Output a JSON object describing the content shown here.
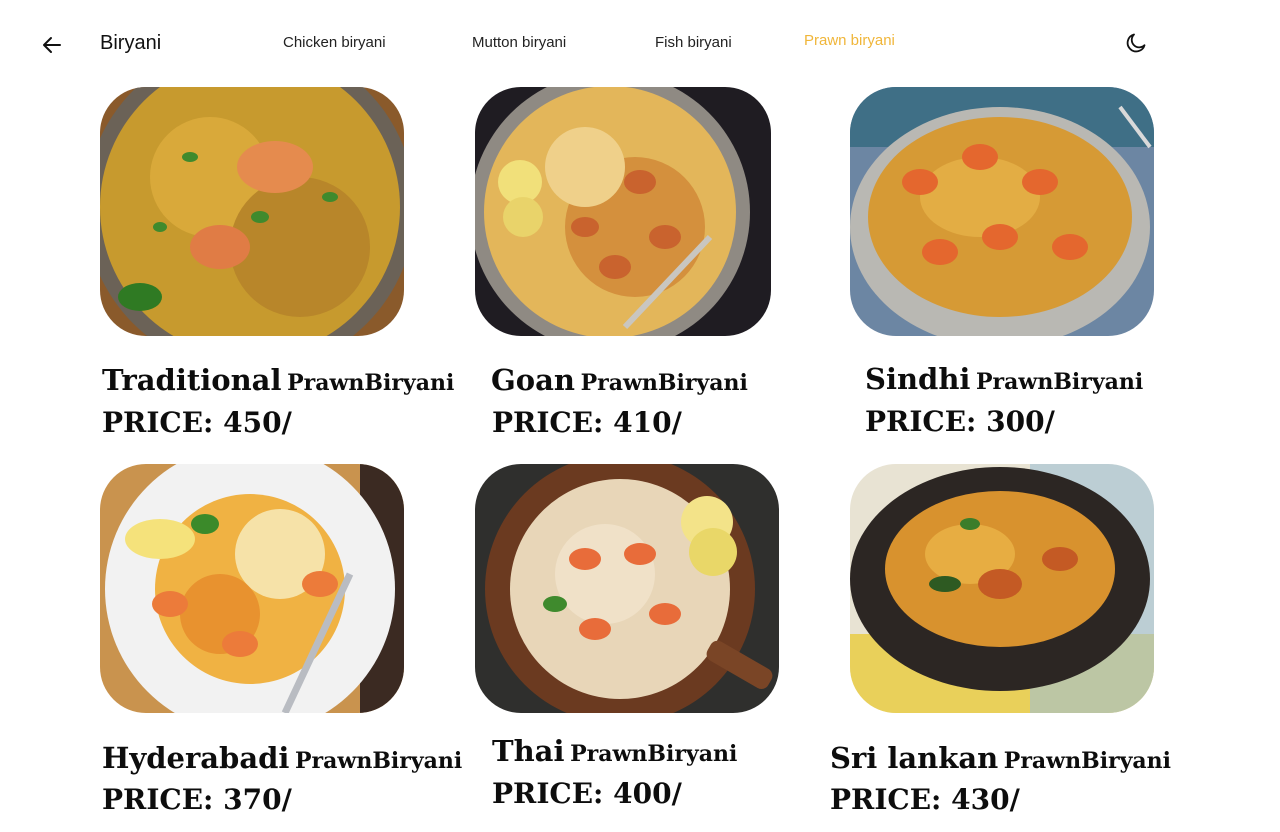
{
  "header": {
    "title": "Biryani",
    "back_icon": "arrow-left-icon",
    "theme_icon": "moon-icon",
    "tabs": [
      {
        "label": "Chicken biryani",
        "active": false
      },
      {
        "label": "Mutton biryani",
        "active": false
      },
      {
        "label": "Fish biryani",
        "active": false
      },
      {
        "label": "Prawn biryani",
        "active": true
      }
    ],
    "active_tab_color": "#f0b63a"
  },
  "items": [
    {
      "name": "Traditional",
      "sub": "PrawnBiryani",
      "price": "PRICE: 450/"
    },
    {
      "name": "Goan",
      "sub": "PrawnBiryani",
      "price": "PRICE: 410/"
    },
    {
      "name": "Sindhi",
      "sub": "PrawnBiryani",
      "price": "PRICE: 300/"
    },
    {
      "name": "Hyderabadi",
      "sub": "PrawnBiryani",
      "price": "PRICE: 370/"
    },
    {
      "name": "Thai",
      "sub": "PrawnBiryani",
      "price": "PRICE: 400/"
    },
    {
      "name": "Sri lankan",
      "sub": "PrawnBiryani",
      "price": "PRICE: 430/"
    }
  ]
}
